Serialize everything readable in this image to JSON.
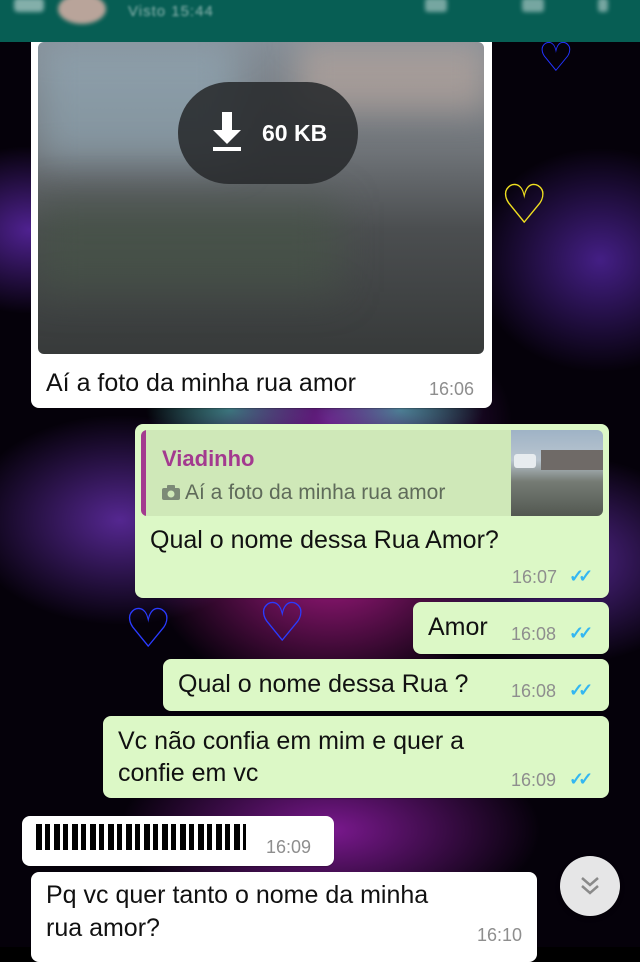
{
  "header": {
    "status_text": "Visto 15:44"
  },
  "messages": {
    "photo_msg": {
      "download_size": "60 KB",
      "caption": "Aí a foto da minha rua amor",
      "time": "16:06"
    },
    "reply_msg": {
      "quoted_author": "Viadinho",
      "quoted_text": "Aí a foto da minha rua amor",
      "text": "Qual o nome dessa Rua Amor?",
      "time": "16:07"
    },
    "amor_msg": {
      "text": "Amor",
      "time": "16:08"
    },
    "qual_msg": {
      "text": "Qual o nome dessa Rua ?",
      "time": "16:08"
    },
    "confia_msg": {
      "text_line1": "Vc não confia em mim e quer a",
      "text_line2": "confie em vc",
      "time": "16:09"
    },
    "censored_msg": {
      "time": "16:09"
    },
    "last_msg": {
      "text_line1": "Pq vc quer tanto o nome da minha",
      "text_line2": "rua amor?",
      "time": "16:10"
    }
  },
  "icons": {
    "double_check": "✓✓",
    "scroll_down": "chevron-double-down-icon",
    "download": "download-arrow-icon",
    "camera": "camera-icon"
  },
  "colors": {
    "header": "#075e54",
    "incoming_bubble": "#ffffff",
    "outgoing_bubble": "#dcf8c6",
    "read_ticks": "#34b7f1",
    "quote_author": "#a33a8f"
  }
}
